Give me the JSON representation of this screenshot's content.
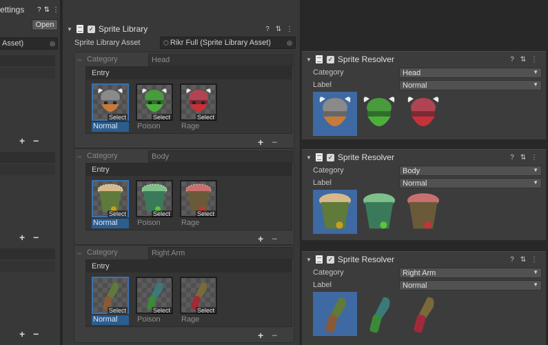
{
  "left_panel": {
    "title": "ettings",
    "open_button": "Open",
    "asset_field": "Asset)"
  },
  "library": {
    "title": "Sprite Library",
    "asset_label": "Sprite Library Asset",
    "asset_value": "Rikr Full (Sprite Library Asset)",
    "category_label": "Category",
    "entry_label": "Entry",
    "select_label": "Select",
    "categories": [
      {
        "name": "Head",
        "entries": [
          "Normal",
          "Poison",
          "Rage"
        ]
      },
      {
        "name": "Body",
        "entries": [
          "Normal",
          "Poison",
          "Rage"
        ]
      },
      {
        "name": "Right Arm",
        "entries": [
          "Normal",
          "Poison",
          "Rage"
        ]
      }
    ]
  },
  "resolvers": [
    {
      "title": "Sprite Resolver",
      "category_label": "Category",
      "category_value": "Head",
      "label_label": "Label",
      "label_value": "Normal"
    },
    {
      "title": "Sprite Resolver",
      "category_label": "Category",
      "category_value": "Body",
      "label_label": "Label",
      "label_value": "Normal"
    },
    {
      "title": "Sprite Resolver",
      "category_label": "Category",
      "category_value": "Right Arm",
      "label_label": "Label",
      "label_value": "Normal"
    }
  ],
  "icons": {
    "help": "?",
    "presets": "⇅",
    "more": "⋮",
    "plus": "+",
    "minus": "−",
    "check": "✓",
    "caret": "▼",
    "fold": "▼",
    "target": "◎"
  },
  "colors": {
    "normal": "#c87a3a",
    "poison": "#4caf3c",
    "rage": "#c8303a",
    "selection": "#3a72b0"
  }
}
